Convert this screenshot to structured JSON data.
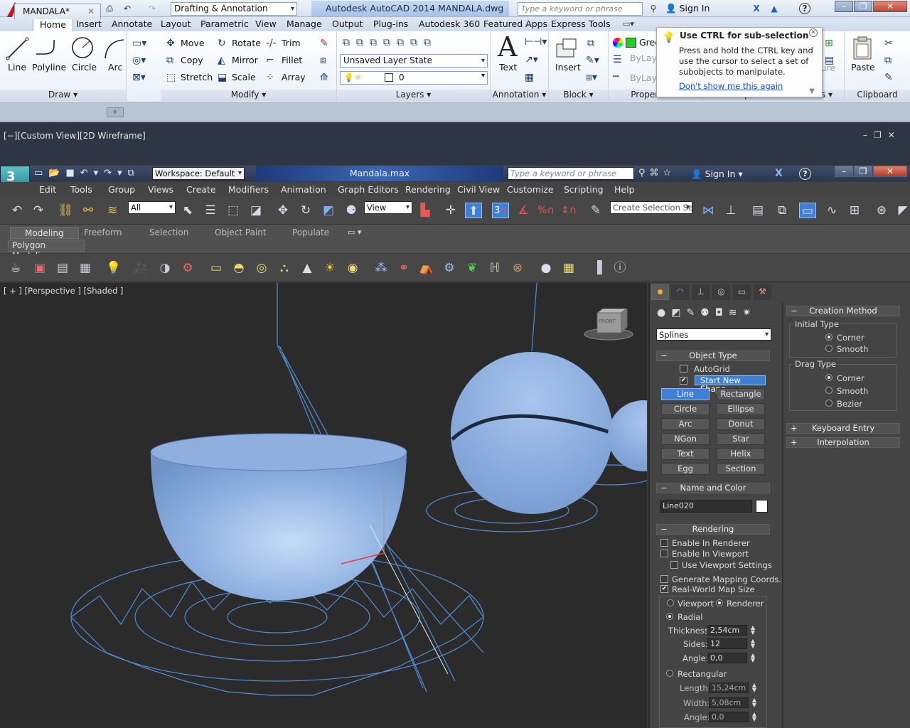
{
  "acad": {
    "workspace": "Drafting & Annotation",
    "title": "Autodesk AutoCAD 2014    MANDALA.dwg",
    "search_placeholder": "Type a keyword or phrase",
    "sign_in": "Sign In",
    "tabs": [
      "Home",
      "Insert",
      "Annotate",
      "Layout",
      "Parametric",
      "View",
      "Manage",
      "Output",
      "Plug-ins",
      "Autodesk 360",
      "Featured Apps",
      "Express Tools"
    ],
    "draw": {
      "line": "Line",
      "polyline": "Polyline",
      "circle": "Circle",
      "arc": "Arc",
      "label": "Draw"
    },
    "modify": {
      "move": "Move",
      "rotate": "Rotate",
      "trim": "Trim",
      "copy": "Copy",
      "mirror": "Mirror",
      "fillet": "Fillet",
      "stretch": "Stretch",
      "scale": "Scale",
      "array": "Array",
      "label": "Modify"
    },
    "layers": {
      "state": "Unsaved Layer State",
      "current": "0",
      "label": "Layers"
    },
    "annotation": {
      "text": "Text",
      "label": "Annotation"
    },
    "block": {
      "insert": "Insert",
      "label": "Block"
    },
    "properties": {
      "color": "Green",
      "bylayer": "ByLayer",
      "label": "Properties"
    },
    "groups_label": "Groups",
    "utilities": {
      "measure": "Measure",
      "label": "Utilities"
    },
    "clipboard": {
      "paste": "Paste",
      "label": "Clipboard"
    },
    "tooltip": {
      "title": "Use CTRL for sub-selection",
      "body": "Press and hold the CTRL key and use the cursor to select a set of subobjects to manipulate.",
      "link": "Don't show me this again"
    },
    "file_tab": "MANDALA*",
    "viewport_label": "[−][Custom View][2D Wireframe]"
  },
  "max": {
    "workspace": "Workspace: Default",
    "title": "Mandala.max",
    "search_placeholder": "Type a keyword or phrase",
    "sign_in": "Sign In",
    "menu": [
      "Edit",
      "Tools",
      "Group",
      "Views",
      "Create",
      "Modifiers",
      "Animation",
      "Graph Editors",
      "Rendering",
      "Civil View",
      "Customize",
      "Scripting",
      "Help"
    ],
    "filter": "All",
    "ref_coord": "View",
    "snap_num": "3",
    "selection_set": "Create Selection Se",
    "ribbon_tabs": [
      "Modeling",
      "Freeform",
      "Selection",
      "Object Paint",
      "Populate"
    ],
    "polygon_modeling": "Polygon Modeling",
    "viewport_label": "[ + ] [Perspective ] [Shaded ]",
    "viewcube_label": "FRONT",
    "panel": {
      "category": "Splines",
      "object_type": {
        "title": "Object Type",
        "autogrid": "AutoGrid",
        "start_new_shape": "Start New Shape",
        "buttons": [
          "Line",
          "Rectangle",
          "Circle",
          "Ellipse",
          "Arc",
          "Donut",
          "NGon",
          "Star",
          "Text",
          "Helix",
          "Egg",
          "Section"
        ]
      },
      "name_color": {
        "title": "Name and Color",
        "name": "Line020"
      },
      "rendering": {
        "title": "Rendering",
        "enable_renderer": "Enable In Renderer",
        "enable_viewport": "Enable In Viewport",
        "use_viewport": "Use Viewport Settings",
        "gen_mapping": "Generate Mapping Coords.",
        "real_world": "Real-World Map Size",
        "viewport": "Viewport",
        "renderer": "Renderer",
        "radial": "Radial",
        "thickness_label": "Thickness:",
        "thickness": "2,54cm",
        "sides_label": "Sides:",
        "sides": "12",
        "angle_label": "Angle:",
        "angle": "0,0",
        "rectangular": "Rectangular",
        "length_label": "Length:",
        "length": "15,24cm",
        "width_label": "Width:",
        "width": "5,08cm",
        "angle2_label": "Angle:",
        "angle2": "0,0"
      },
      "creation_method": {
        "title": "Creation Method",
        "initial_type": "Initial Type",
        "corner": "Corner",
        "smooth": "Smooth",
        "drag_type": "Drag Type",
        "drag_corner": "Corner",
        "drag_smooth": "Smooth",
        "bezier": "Bezier"
      },
      "keyboard_entry": "Keyboard Entry",
      "interpolation": "Interpolation"
    }
  }
}
